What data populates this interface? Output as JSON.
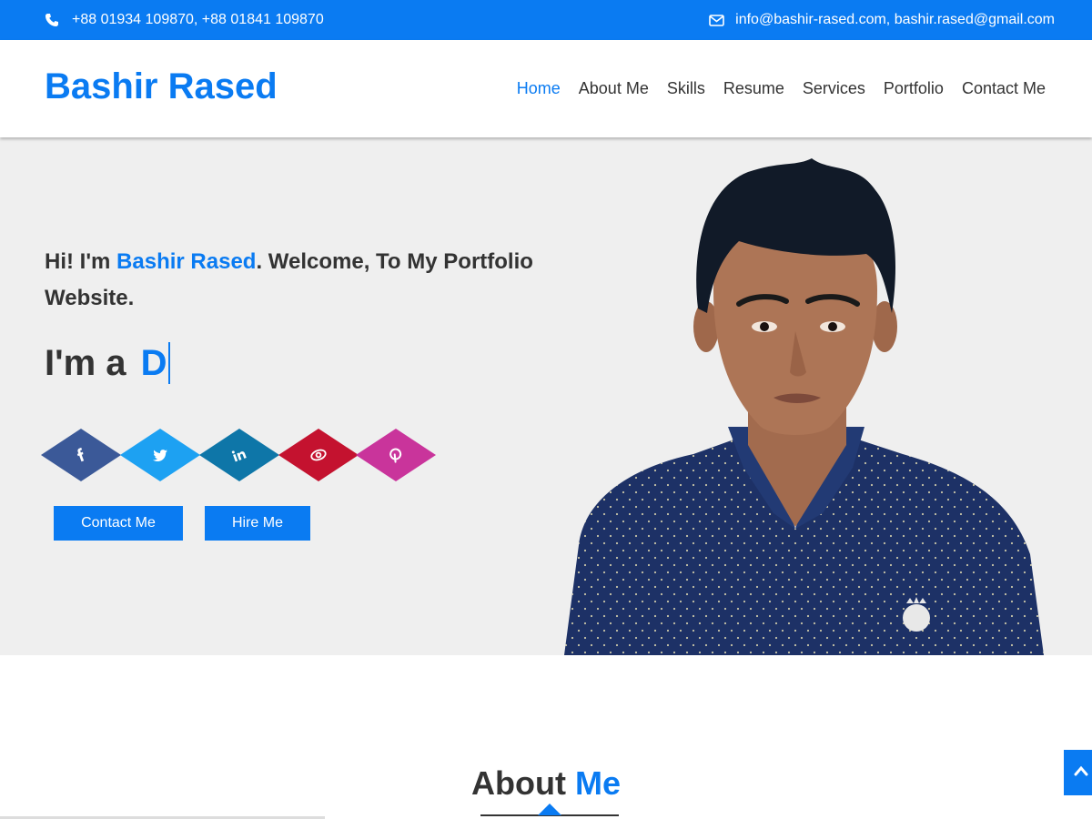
{
  "topbar": {
    "phone": "+88 01934 109870, +88 01841 109870",
    "email": "info@bashir-rased.com, bashir.rased@gmail.com",
    "phone_icon": "phone-icon",
    "email_icon": "envelope-icon"
  },
  "header": {
    "brand": "Bashir Rased",
    "nav": [
      {
        "label": "Home",
        "active": true
      },
      {
        "label": "About Me"
      },
      {
        "label": "Skills"
      },
      {
        "label": "Resume"
      },
      {
        "label": "Services"
      },
      {
        "label": "Portfolio"
      },
      {
        "label": "Contact Me"
      }
    ]
  },
  "hero": {
    "greeting_prefix": "Hi! I'm ",
    "greeting_name": "Bashir Rased",
    "greeting_suffix": ". Welcome, To My Portfolio Website.",
    "typed_prefix": "I'm a",
    "typed_word": "D",
    "socials": [
      {
        "name": "facebook",
        "icon": "facebook-icon",
        "color": "#3b5998"
      },
      {
        "name": "twitter",
        "icon": "twitter-icon",
        "color": "#1da1f2"
      },
      {
        "name": "linkedin",
        "icon": "linkedin-icon",
        "color": "#0e76a8"
      },
      {
        "name": "behance",
        "icon": "eye-icon",
        "color": "#c4122f"
      },
      {
        "name": "pinterest",
        "icon": "pinterest-icon",
        "color": "#c9349b"
      }
    ],
    "buttons": {
      "contact": "Contact Me",
      "hire": "Hire Me"
    }
  },
  "about": {
    "title_1": "About ",
    "title_2": "Me"
  },
  "colors": {
    "accent": "#0a7bf2",
    "hero_bg": "#efefef",
    "text": "#333333"
  }
}
